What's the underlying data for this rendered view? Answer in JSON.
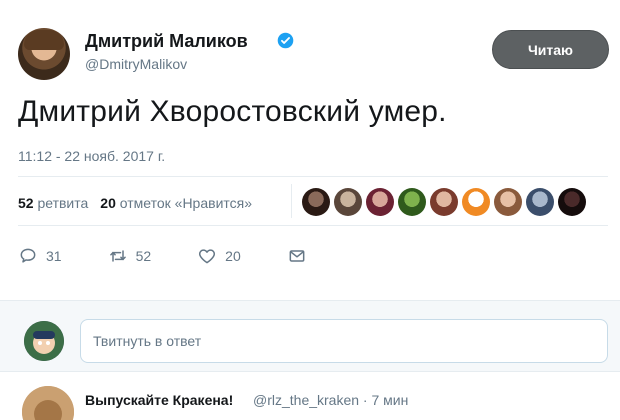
{
  "tweet": {
    "author_name": "Дмитрий Маликов",
    "author_handle": "@DmitryMalikov",
    "follow_label": "Читаю",
    "text": "Дмитрий Хворостовский умер.",
    "timestamp": "11:12 - 22 нояб. 2017 г.",
    "stats": {
      "retweets_count": "52",
      "retweets_label": "ретвита",
      "likes_count": "20",
      "likes_label": "отметок «Нравится»"
    },
    "likers": [
      "liker-1",
      "liker-2",
      "liker-3",
      "liker-4",
      "liker-5",
      "liker-6",
      "liker-7",
      "liker-8",
      "liker-9"
    ],
    "actions": {
      "replies": "31",
      "retweets": "52",
      "likes": "20"
    },
    "colors": {
      "verified": "#1da1f2",
      "follow_bg": "#5d6163",
      "muted": "#657786"
    }
  },
  "reply_box": {
    "placeholder": "Твитнуть в ответ"
  },
  "reply_tweet": {
    "author_name": "Выпускайте Кракена!",
    "handle_time": "@rlz_the_kraken · 7 мин"
  },
  "icons": {
    "verified": "verified-badge-icon",
    "reply": "speech-bubble-icon",
    "retweet": "retweet-arrows-icon",
    "like": "heart-icon",
    "dm": "envelope-icon"
  }
}
